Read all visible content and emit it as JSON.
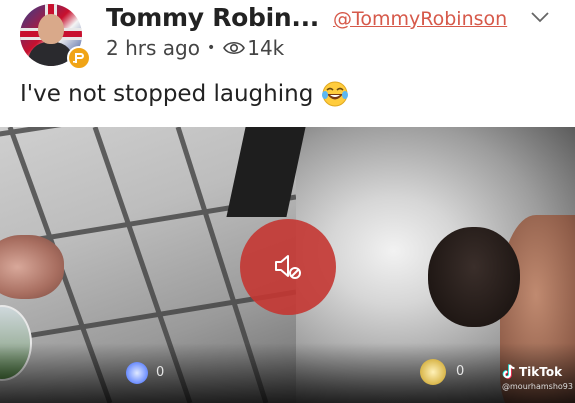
{
  "post": {
    "author_name": "Tommy Robin...",
    "author_handle": "@TommyRobinson",
    "time_ago": "2 hrs ago",
    "separator": "•",
    "view_count": "14k",
    "text": "I've not stopped laughing"
  },
  "icons": {
    "badge": "p-badge-icon",
    "menu": "chevron-down-icon",
    "views": "eye-icon",
    "emoji": "laughing-crying-emoji",
    "mute": "speaker-muted-icon",
    "watermark": "tiktok-logo-icon"
  },
  "video": {
    "left_reaction_count": "0",
    "right_reaction_count": "0",
    "watermark_label": "TikTok",
    "watermark_user": "@mourhamsho93"
  },
  "colors": {
    "handle": "#d6594a",
    "badge": "#f0a416",
    "mute_button": "#c43632"
  }
}
